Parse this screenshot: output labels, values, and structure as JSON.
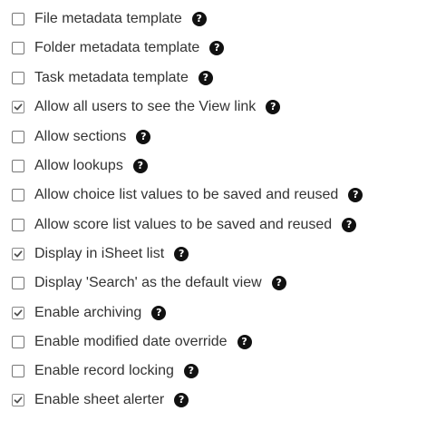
{
  "options": [
    {
      "label": "File metadata template",
      "checked": false,
      "help_glyph": "?",
      "icon": "question-circle-icon"
    },
    {
      "label": "Folder metadata template",
      "checked": false,
      "help_glyph": "?",
      "icon": "question-circle-icon"
    },
    {
      "label": "Task metadata template",
      "checked": false,
      "help_glyph": "?",
      "icon": "question-circle-icon"
    },
    {
      "label": "Allow all users to see the View link",
      "checked": true,
      "help_glyph": "?",
      "icon": "question-circle-icon"
    },
    {
      "label": "Allow sections",
      "checked": false,
      "help_glyph": "?",
      "icon": "question-circle-icon"
    },
    {
      "label": "Allow lookups",
      "checked": false,
      "help_glyph": "?",
      "icon": "question-circle-icon"
    },
    {
      "label": "Allow choice list values to be saved and reused",
      "checked": false,
      "help_glyph": "?",
      "icon": "question-circle-icon"
    },
    {
      "label": "Allow score list values to be saved and reused",
      "checked": false,
      "help_glyph": "?",
      "icon": "question-circle-icon"
    },
    {
      "label": "Display in iSheet list",
      "checked": true,
      "help_glyph": "?",
      "icon": "question-circle-icon"
    },
    {
      "label": "Display 'Search' as the default view",
      "checked": false,
      "help_glyph": "?",
      "icon": "question-circle-icon"
    },
    {
      "label": "Enable archiving",
      "checked": true,
      "help_glyph": "?",
      "icon": "question-circle-icon"
    },
    {
      "label": "Enable modified date override",
      "checked": false,
      "help_glyph": "?",
      "icon": "question-circle-icon"
    },
    {
      "label": "Enable record locking",
      "checked": false,
      "help_glyph": "?",
      "icon": "question-circle-icon"
    },
    {
      "label": "Enable sheet alerter",
      "checked": true,
      "help_glyph": "?",
      "icon": "question-circle-icon"
    }
  ]
}
